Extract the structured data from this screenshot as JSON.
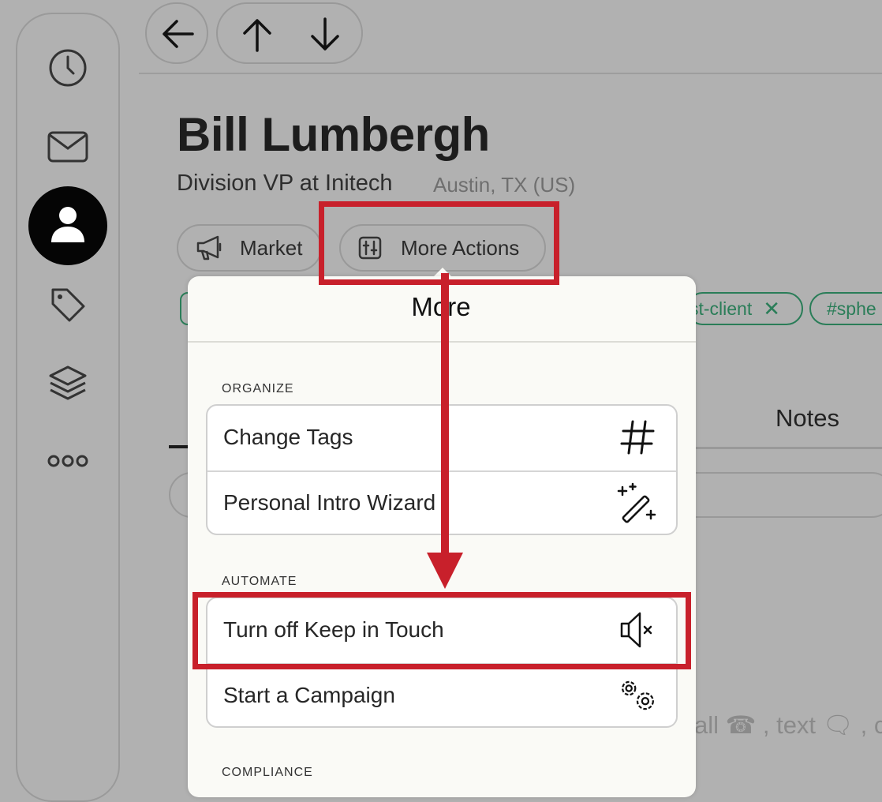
{
  "contact": {
    "name": "Bill Lumbergh",
    "title": "Division VP at Initech",
    "location": "Austin, TX (US)"
  },
  "actions": {
    "market_label": "Market",
    "more_actions_label": "More Actions"
  },
  "tags": {
    "tag1": "st-client",
    "tag2": "#sphe"
  },
  "background": {
    "tab_notes": "Notes",
    "hint_text": "all ☎ , text 🗨 , c"
  },
  "popover": {
    "title": "More",
    "sections": [
      {
        "heading": "Organize",
        "items": [
          {
            "label": "Change Tags",
            "icon": "hashtag-icon"
          },
          {
            "label": "Personal Intro Wizard",
            "icon": "magic-wand-icon"
          }
        ]
      },
      {
        "heading": "Automate",
        "items": [
          {
            "label": "Turn off Keep in Touch",
            "icon": "speaker-mute-icon"
          },
          {
            "label": "Start a Campaign",
            "icon": "gears-icon"
          }
        ]
      },
      {
        "heading": "Compliance"
      }
    ]
  },
  "sidebar": {
    "items": [
      {
        "icon": "clock-icon"
      },
      {
        "icon": "mail-icon"
      },
      {
        "icon": "person-icon",
        "active": true
      },
      {
        "icon": "tag-icon"
      },
      {
        "icon": "layers-icon"
      },
      {
        "icon": "more-dots-icon"
      }
    ]
  },
  "colors": {
    "annotation_red": "#c8202b",
    "tag_green": "#2a7d58",
    "backdrop": "#b1b1b1"
  }
}
